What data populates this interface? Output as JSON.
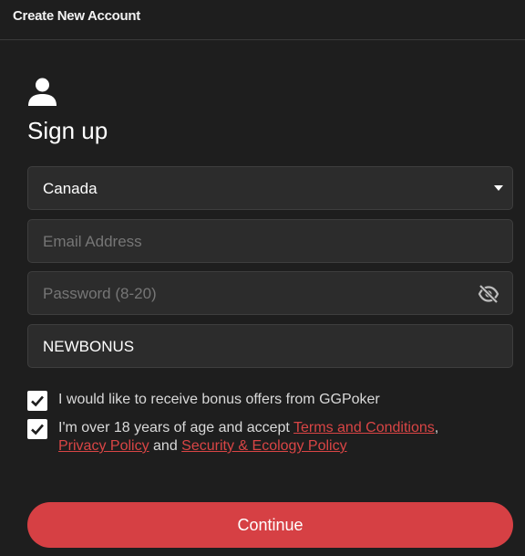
{
  "window": {
    "title": "Create New Account"
  },
  "form": {
    "heading": "Sign up",
    "country": {
      "value": "Canada"
    },
    "email": {
      "placeholder": "Email Address",
      "value": ""
    },
    "password": {
      "placeholder": "Password (8-20)",
      "value": ""
    },
    "promo_code": {
      "value": "NEWBONUS"
    },
    "bonus_checkbox": {
      "checked": true,
      "label": "I would like to receive bonus offers from GGPoker"
    },
    "terms_checkbox": {
      "checked": true,
      "label_prefix": "I'm over 18 years of age and accept ",
      "terms_link": "Terms and Conditions",
      "comma": ",",
      "privacy_link": "Privacy Policy",
      "and_text": " and ",
      "security_link": "Security & Ecology Policy"
    },
    "continue_label": "Continue"
  },
  "icons": {
    "user": "user-icon",
    "dropdown": "caret-down-icon",
    "password_toggle": "eye-slash-icon",
    "checkbox": "checkmark-icon"
  },
  "colors": {
    "background": "#1e1e1e",
    "field": "#2c2c2c",
    "accent": "#d64044",
    "link": "#d94545"
  }
}
